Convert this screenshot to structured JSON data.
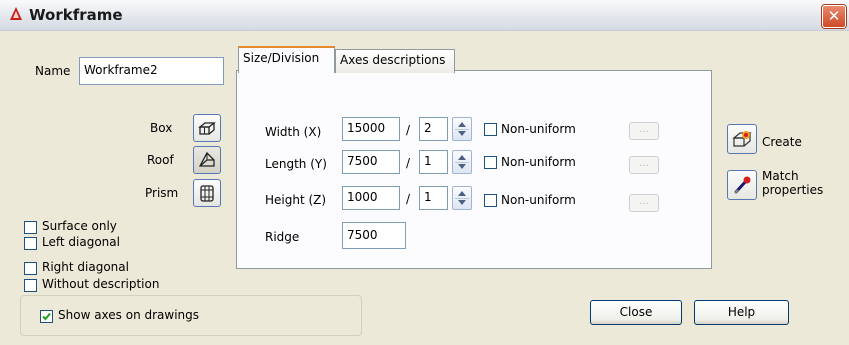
{
  "window": {
    "title": "Workframe",
    "close_glyph": "✕"
  },
  "name_field": {
    "label": "Name",
    "value": "Workframe2"
  },
  "shapes": [
    {
      "label": "Box",
      "icon": "box-shape-icon",
      "active": false
    },
    {
      "label": "Roof",
      "icon": "roof-shape-icon",
      "active": true
    },
    {
      "label": "Prism",
      "icon": "prism-shape-icon",
      "active": false
    }
  ],
  "options": [
    {
      "label": "Surface only",
      "checked": false
    },
    {
      "label": "Left diagonal",
      "checked": false
    },
    {
      "label": "Right diagonal",
      "checked": false
    },
    {
      "label": "Without description",
      "checked": false
    }
  ],
  "show_axes": {
    "label": "Show axes on drawings",
    "checked": true
  },
  "tabs": [
    {
      "label": "Size/Division",
      "selected": true
    },
    {
      "label": "Axes descriptions",
      "selected": false
    }
  ],
  "dimensions": [
    {
      "label": "Width (X)",
      "value": "15000",
      "sep": "/",
      "division": "2",
      "nonuniform_label": "Non-uniform",
      "nonuniform_checked": false,
      "button": "..."
    },
    {
      "label": "Length (Y)",
      "value": "7500",
      "sep": "/",
      "division": "1",
      "nonuniform_label": "Non-uniform",
      "nonuniform_checked": false,
      "button": "..."
    },
    {
      "label": "Height (Z)",
      "value": "1000",
      "sep": "/",
      "division": "1",
      "nonuniform_label": "Non-uniform",
      "nonuniform_checked": false,
      "button": "..."
    }
  ],
  "ridge": {
    "label": "Ridge",
    "value": "7500"
  },
  "actions": {
    "create": {
      "label": "Create",
      "icon": "create-workframe-icon"
    },
    "match": {
      "label_line1": "Match",
      "label_line2": "properties",
      "icon": "match-properties-icon"
    }
  },
  "buttons": {
    "close": "Close",
    "help": "Help"
  },
  "colors": {
    "tab_highlight": "#e68b2c",
    "window_bg": "#ece9d8",
    "close_button": "#cf4a26",
    "check": "#21a121"
  }
}
